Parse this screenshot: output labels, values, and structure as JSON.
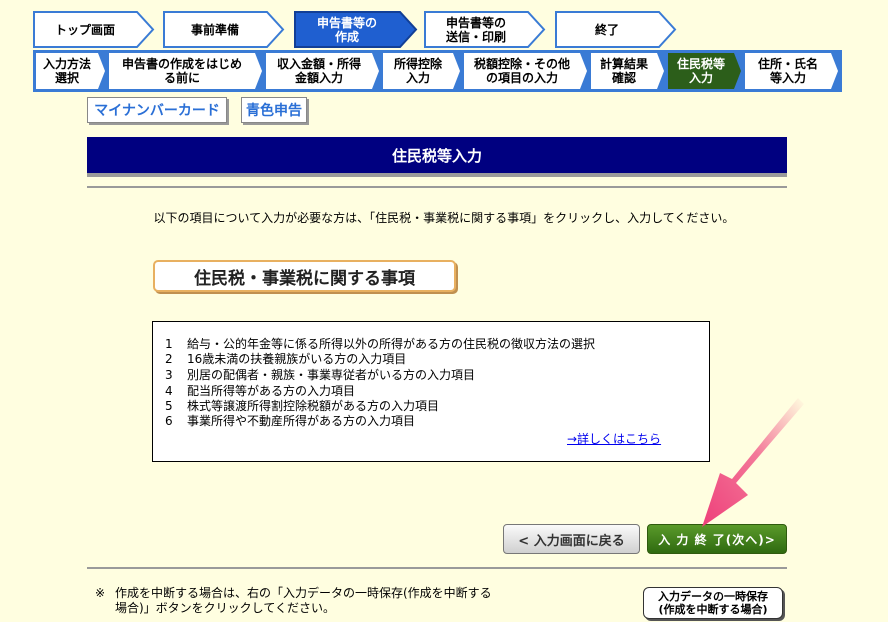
{
  "steps": [
    {
      "label": "トップ画面",
      "state": "done"
    },
    {
      "label": "事前準備",
      "state": "done"
    },
    {
      "label": "申告書等の\n作成",
      "state": "current"
    },
    {
      "label": "申告書等の\n送信・印刷",
      "state": "todo"
    },
    {
      "label": "終了",
      "state": "todo"
    }
  ],
  "substeps": [
    {
      "label": "入力方法\n選択",
      "active": false
    },
    {
      "label": "申告書の作成をはじめ\nる前に",
      "active": false
    },
    {
      "label": "収入金額・所得\n金額入力",
      "active": false
    },
    {
      "label": "所得控除\n入力",
      "active": false
    },
    {
      "label": "税額控除・その他\nの項目の入力",
      "active": false
    },
    {
      "label": "計算結果\n確認",
      "active": false
    },
    {
      "label": "住民税等\n入力",
      "active": true
    },
    {
      "label": "住所・氏名\n等入力",
      "active": false
    }
  ],
  "tabs": {
    "mynumber": "マイナンバーカード",
    "blue": "青色申告"
  },
  "page_title": "住民税等入力",
  "intro": "以下の項目について入力が必要な方は、「住民税・事業税に関する事項」をクリックし、入力してください。",
  "section_button": "住民税・事業税に関する事項",
  "items": [
    {
      "no": "1",
      "text": "給与・公的年金等に係る所得以外の所得がある方の住民税の徴収方法の選択"
    },
    {
      "no": "2",
      "text": "16歳未満の扶養親族がいる方の入力項目"
    },
    {
      "no": "3",
      "text": "別居の配偶者・親族・事業専従者がいる方の入力項目"
    },
    {
      "no": "4",
      "text": "配当所得等がある方の入力項目"
    },
    {
      "no": "5",
      "text": "株式等譲渡所得割控除税額がある方の入力項目"
    },
    {
      "no": "6",
      "text": "事業所得や不動産所得がある方の入力項目"
    }
  ],
  "detail_link": "→詳しくはこちら",
  "buttons": {
    "back": "< 入力画面に戻る",
    "next": "入 力 終 了(次へ)>",
    "save": "入力データの一時保存\n(作成を中断する場合)"
  },
  "note_mark": "※",
  "note": "作成を中断する場合は、右の「入力データの一時保存(作成を中断する場合)」ボタンをクリックしてください。",
  "colors": {
    "page_bg": "#fffee0",
    "title_bar": "#000080",
    "current_step": "#1f5fd0",
    "active_substep": "#2c5e1a",
    "next_button": "#3f7a1a",
    "arrow": "#ee3f7a"
  }
}
